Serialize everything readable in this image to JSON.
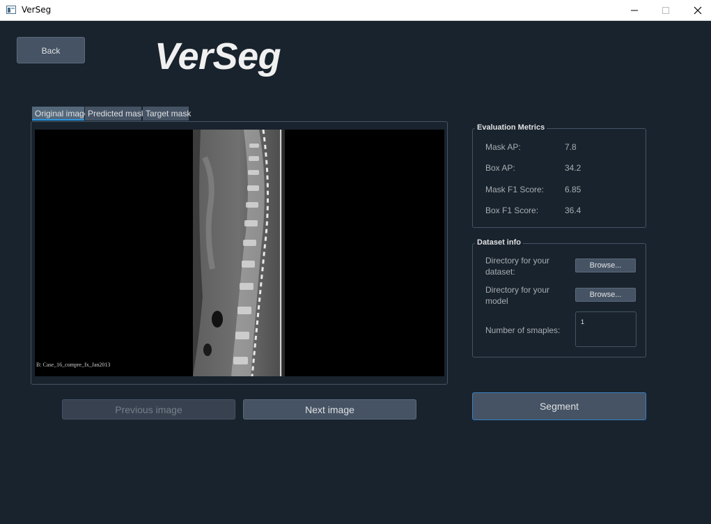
{
  "window": {
    "title": "VerSeg"
  },
  "app": {
    "title": "VerSeg",
    "back_label": "Back"
  },
  "tabs": [
    {
      "label": "Original image",
      "active": true
    },
    {
      "label": "Predicted mask",
      "active": false
    },
    {
      "label": "Target mask",
      "active": false
    }
  ],
  "viewer": {
    "case_label": "B: Case_16_compre_fx_Jan2013"
  },
  "navigation": {
    "previous_label": "Previous image",
    "next_label": "Next image",
    "previous_enabled": false
  },
  "metrics": {
    "title": "Evaluation Metrics",
    "items": [
      {
        "label": "Mask AP:",
        "value": "7.8"
      },
      {
        "label": "Box AP:",
        "value": "34.2"
      },
      {
        "label": "Mask F1 Score:",
        "value": "6.85"
      },
      {
        "label": "Box F1 Score:",
        "value": "36.4"
      }
    ]
  },
  "dataset": {
    "title": "Dataset info",
    "dataset_dir_label": "Directory for your dataset:",
    "model_dir_label": "Directory for your model",
    "browse_label": "Browse...",
    "samples_label": "Number of smaples:",
    "samples_value": "1"
  },
  "segment_label": "Segment",
  "colors": {
    "background": "#19232d",
    "accent": "#259ae9",
    "button": "#455364"
  }
}
